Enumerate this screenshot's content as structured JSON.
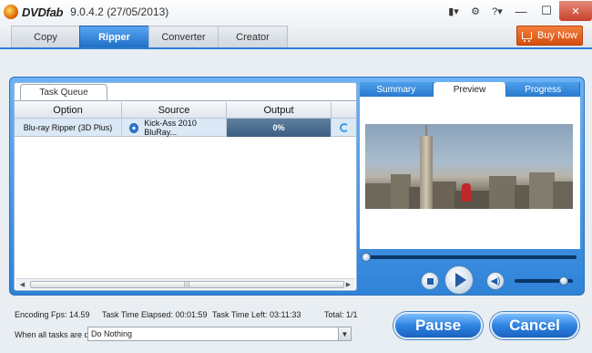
{
  "window": {
    "logo_text": "DVDfab",
    "version": "9.0.4.2 (27/05/2013)",
    "controls": [
      "▮▾",
      "⚙",
      "?▾",
      "—",
      "☐",
      "✕"
    ]
  },
  "nav": {
    "tabs": [
      {
        "label": "Copy",
        "active": false
      },
      {
        "label": "Ripper",
        "active": true
      },
      {
        "label": "Converter",
        "active": false
      },
      {
        "label": "Creator",
        "active": false
      }
    ],
    "buy_now": "Buy Now"
  },
  "queue": {
    "tab_label": "Task Queue",
    "columns": [
      "Option",
      "Source",
      "Output",
      ""
    ],
    "rows": [
      {
        "option": "Blu-ray Ripper (3D Plus)",
        "source": "Kick-Ass 2010 BluRay...",
        "output": "0%"
      }
    ],
    "scroll_grip": "|||"
  },
  "preview": {
    "tabs": [
      {
        "label": "Summary",
        "active": false
      },
      {
        "label": "Preview",
        "active": true
      },
      {
        "label": "Progress",
        "active": false
      }
    ],
    "seek_position": 0,
    "volume_level": 0.85
  },
  "status": {
    "fps": "Encoding Fps: 14.59",
    "elapsed": "Task Time Elapsed: 00:01:59",
    "left": "Task Time Left: 03:11:33",
    "total": "Total: 1/1"
  },
  "finish": {
    "label": "When all tasks are done:",
    "value": "Do Nothing"
  },
  "buttons": {
    "pause": "Pause",
    "cancel": "Cancel"
  },
  "colors": {
    "accent": "#2f83d8",
    "active_tab": "#1f6fc7",
    "buy_now": "#e0591a",
    "progress_cell": "#4a6c90"
  }
}
